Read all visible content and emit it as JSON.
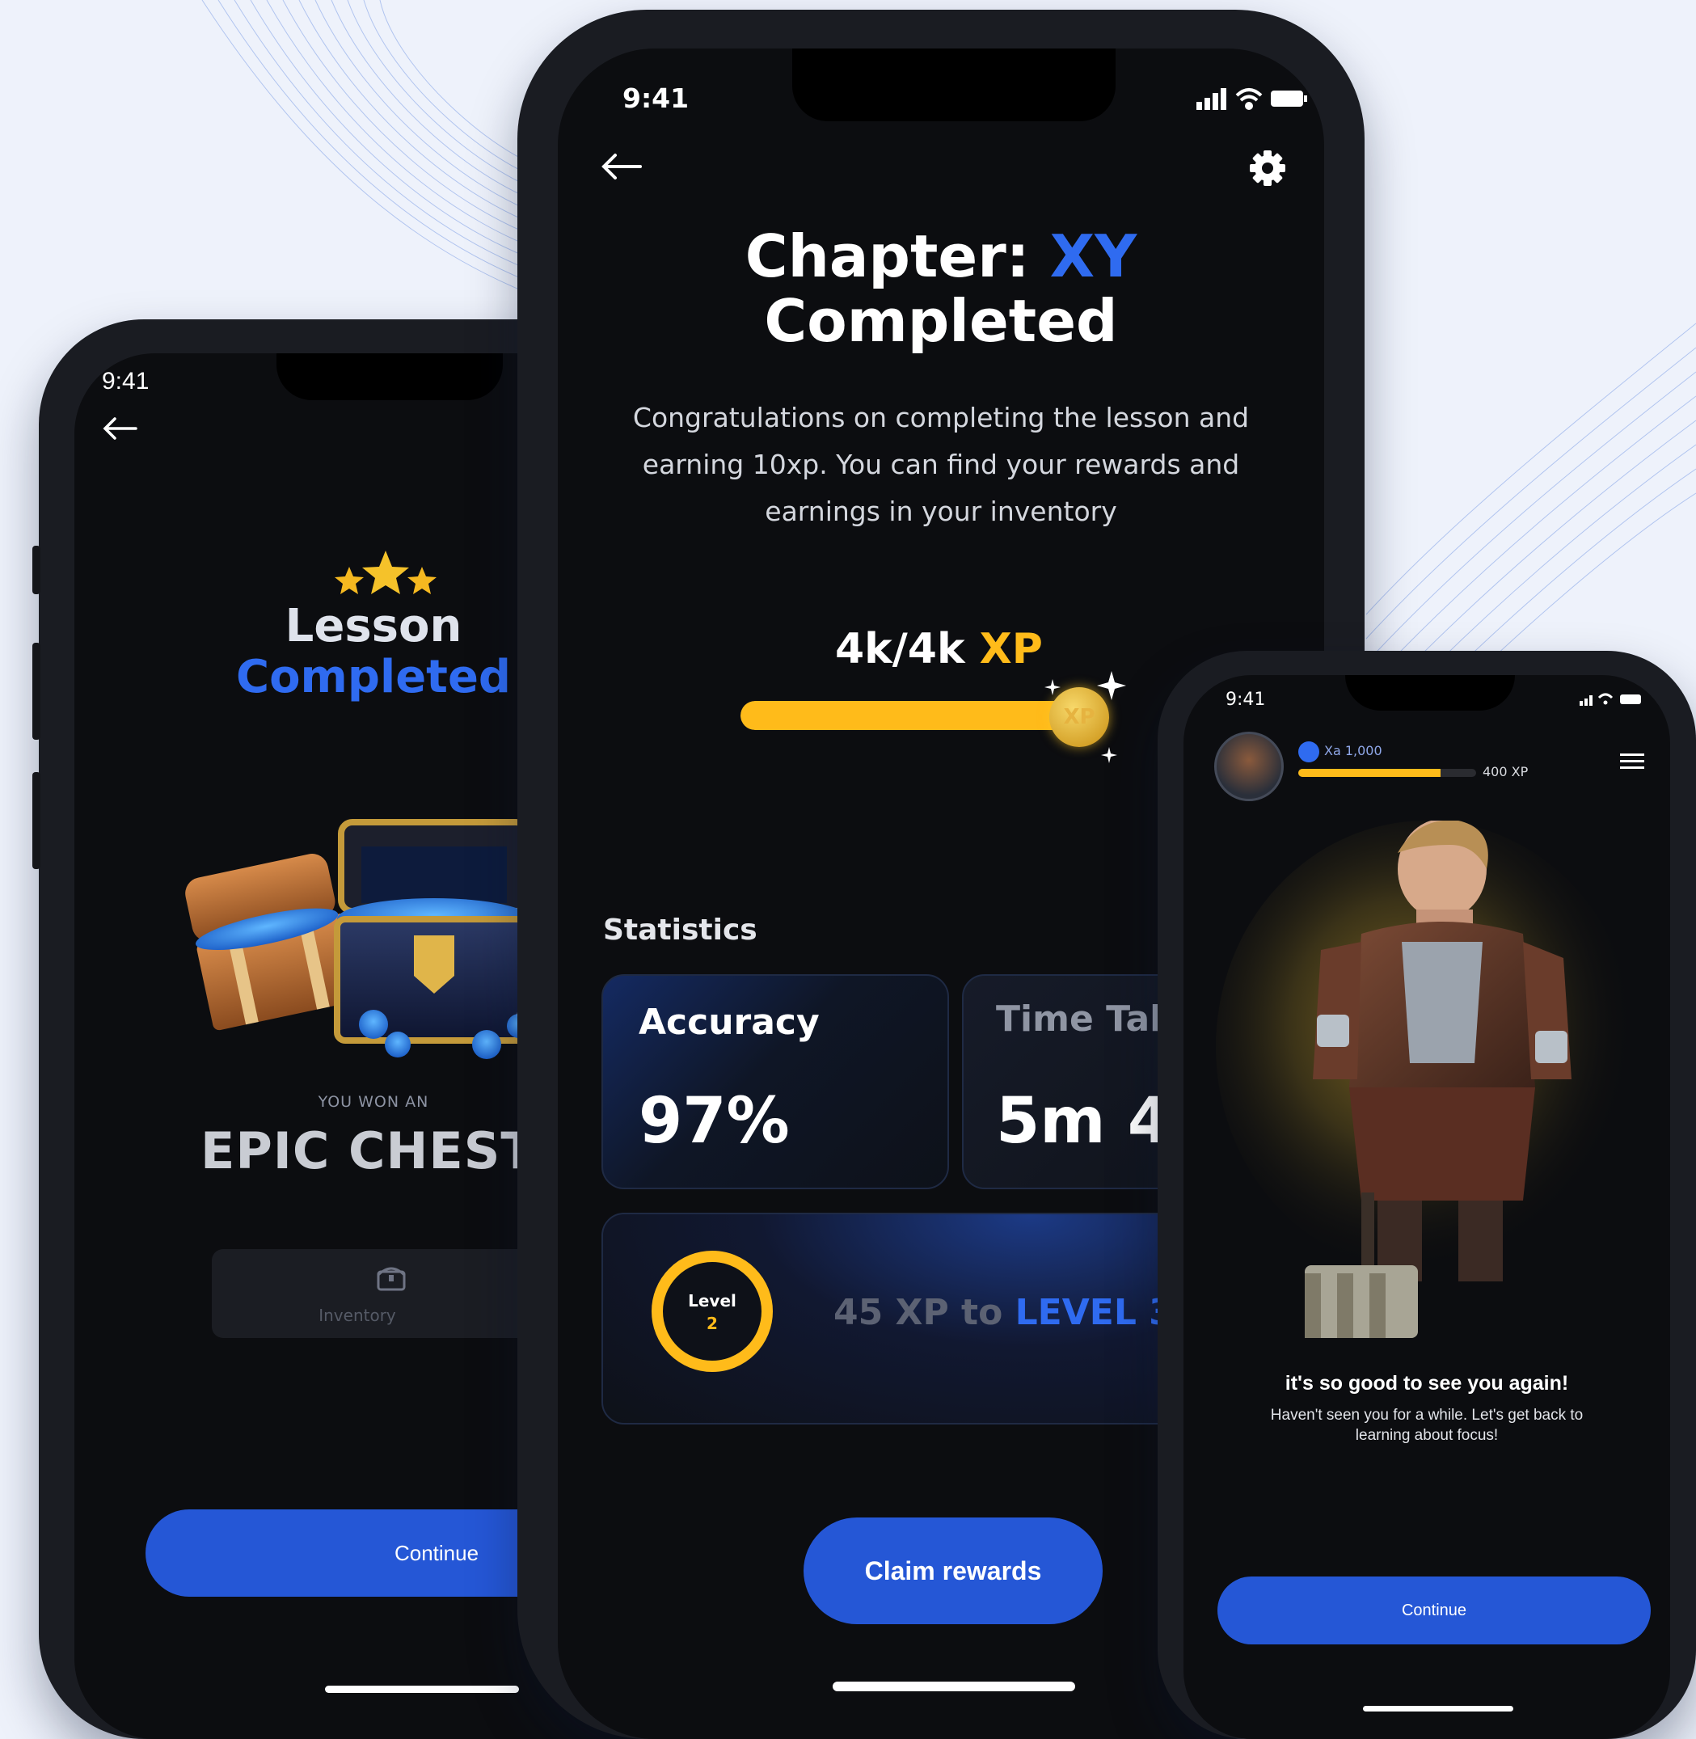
{
  "colors": {
    "accent_blue": "#2f6bf0",
    "xp_gold": "#ffbb1a",
    "button_blue": "#2557d6",
    "background": "#eef2fb",
    "screen": "#0c0d10"
  },
  "left_phone": {
    "time": "9:41",
    "title_line1": "Lesson",
    "title_line2": "Completed",
    "won_label": "YOU WON AN",
    "prize": "EPIC CHEST",
    "inventory_label": "Inventory",
    "continue_label": "Continue",
    "icons": [
      "back-arrow-icon",
      "stars-icon",
      "treasure-chest-image",
      "chest-icon"
    ]
  },
  "center_phone": {
    "time": "9:41",
    "title_prefix": "Chapter: ",
    "title_highlight": "XY",
    "title_line2": "Completed",
    "message_line1": "Congratulations on completing the lesson and",
    "message_line2": "earning 10xp. You can find your rewards and",
    "message_line3": "earnings in your inventory",
    "xp_value": "4k/4k ",
    "xp_unit": "XP",
    "xp_badge": "XP",
    "xp_progress": 1.0,
    "statistics_label": "Statistics",
    "accuracy_label": "Accuracy",
    "accuracy_value": "97%",
    "time_label": "Time Taken",
    "time_value": "5m 4",
    "level_label": "Level",
    "level_number": "2",
    "level_prefix": "45 XP to ",
    "level_target": "LEVEL 3",
    "claim_label": "Claim rewards",
    "icons": [
      "back-arrow-icon",
      "settings-gear-icon",
      "signal-icon",
      "wifi-icon",
      "battery-icon",
      "sparkle-icon"
    ]
  },
  "right_phone": {
    "time": "9:41",
    "player_tag": "Xa 1,000",
    "xp_label": "400 XP",
    "xp_progress": 0.8,
    "greeting": "it's so good to see you again!",
    "message_line1": "Haven't seen you for a while. Let's get back to",
    "message_line2": "learning about focus!",
    "continue_label": "Continue",
    "icons": [
      "avatar",
      "menu-icon",
      "character-image",
      "hammer-image"
    ]
  }
}
